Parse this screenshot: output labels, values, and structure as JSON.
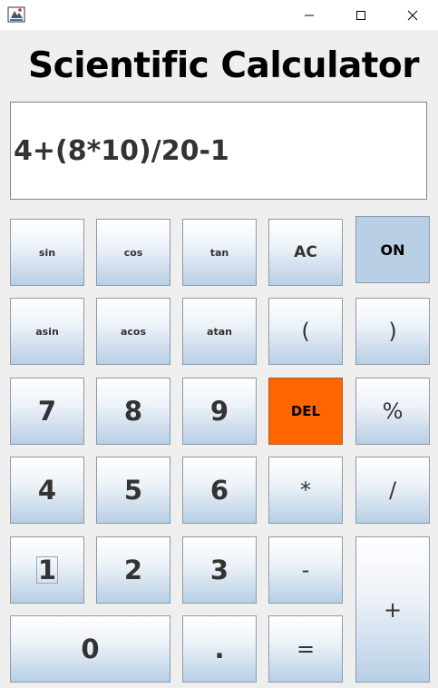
{
  "window": {
    "minimize_icon": "minimize-icon",
    "maximize_icon": "maximize-icon",
    "close_icon": "close-icon",
    "app_icon": "java-cup-icon"
  },
  "header": {
    "title": "Scientific Calculator"
  },
  "display": {
    "expression": "4+(8*10)/20-1"
  },
  "keys": {
    "sin": "sin",
    "cos": "cos",
    "tan": "tan",
    "ac": "AC",
    "on": "ON",
    "asin": "asin",
    "acos": "acos",
    "atan": "atan",
    "open_paren": "(",
    "close_paren": ")",
    "seven": "7",
    "eight": "8",
    "nine": "9",
    "del": "DEL",
    "percent": "%",
    "four": "4",
    "five": "5",
    "six": "6",
    "multiply": "*",
    "divide": "/",
    "one": "1",
    "two": "2",
    "three": "3",
    "minus": "-",
    "plus": "+",
    "zero": "0",
    "dot": ".",
    "equals": "="
  },
  "colors": {
    "del_button": "#ff6600",
    "on_button": "#b8cfe5",
    "key_gradient_bottom": "#b8cfe5"
  }
}
